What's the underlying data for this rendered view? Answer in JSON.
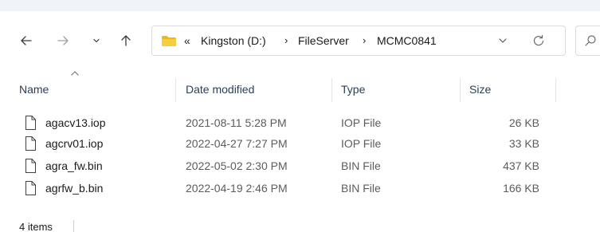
{
  "address_bar": {
    "overflow_glyph": "«",
    "crumbs": [
      "Kingston (D:)",
      "FileServer",
      "MCMC0841"
    ],
    "separator": "›"
  },
  "columns": {
    "name": "Name",
    "date_modified": "Date modified",
    "type": "Type",
    "size": "Size",
    "sorted_by": "name"
  },
  "files": [
    {
      "name": "agacv13.iop",
      "date": "2021-08-11 5:28 PM",
      "type": "IOP File",
      "size": "26 KB"
    },
    {
      "name": "agcrv01.iop",
      "date": "2022-04-27 7:27 PM",
      "type": "IOP File",
      "size": "33 KB"
    },
    {
      "name": "agra_fw.bin",
      "date": "2022-05-02 2:30 PM",
      "type": "BIN File",
      "size": "437 KB"
    },
    {
      "name": "agrfw_b.bin",
      "date": "2022-04-19 2:46 PM",
      "type": "BIN File",
      "size": "166 KB"
    }
  ],
  "status_bar": {
    "item_count": "4 items"
  },
  "icons": {
    "back": "arrow-left-icon",
    "forward": "arrow-right-icon",
    "recent": "chevron-down-icon",
    "up": "arrow-up-icon",
    "folder": "folder-icon",
    "dropdown": "chevron-down-icon",
    "refresh": "refresh-icon",
    "search": "search-icon",
    "file": "file-icon"
  },
  "colors": {
    "folder": "#f2b90d",
    "header_text": "#2a3f57",
    "secondary_text": "#5c5c5c"
  }
}
